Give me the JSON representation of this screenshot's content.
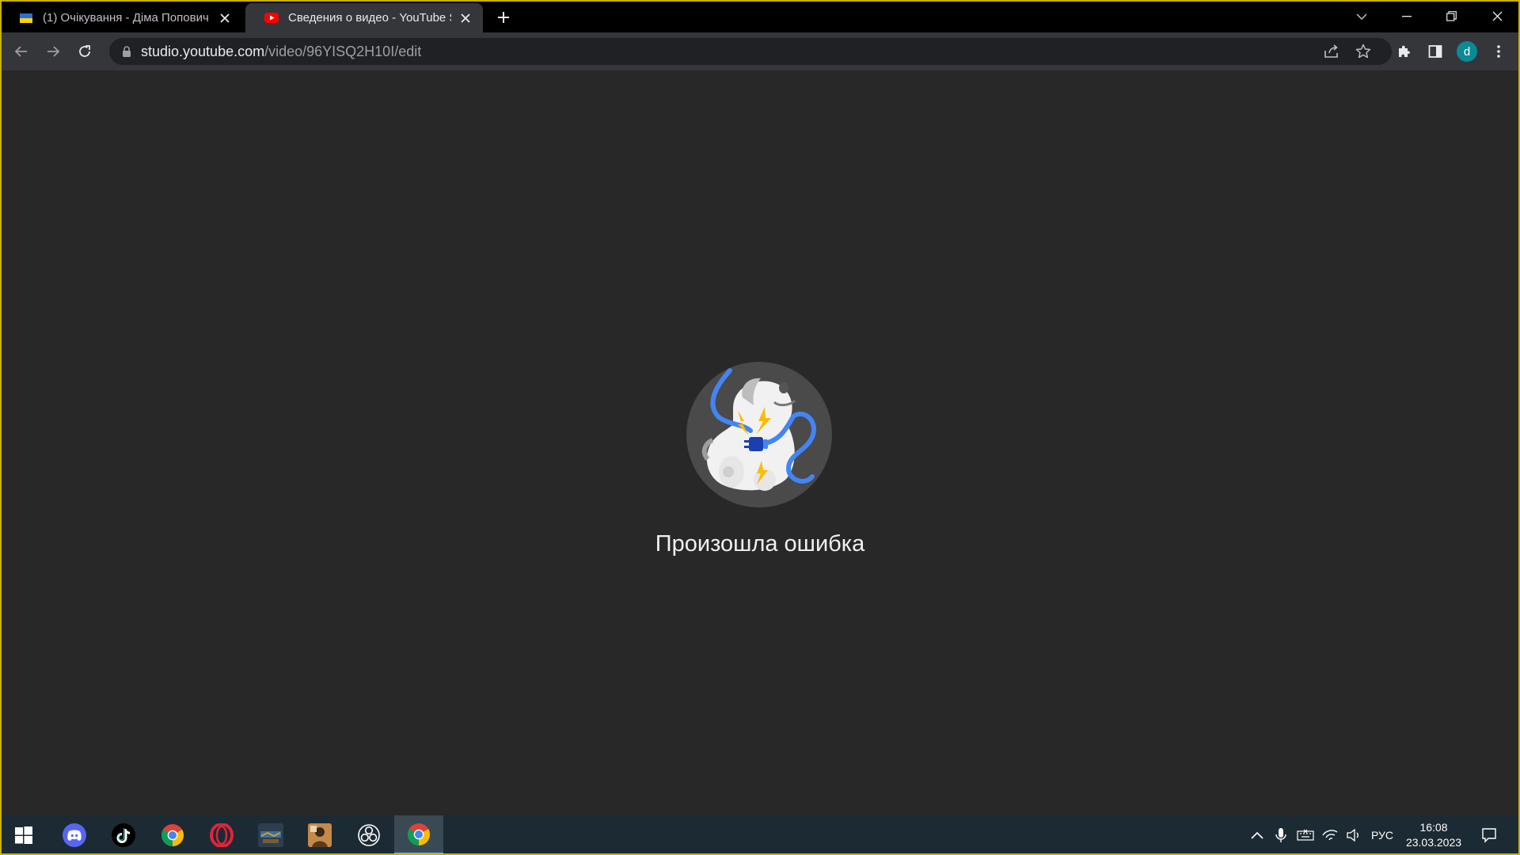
{
  "browser": {
    "tabs": [
      {
        "title": "(1) Очікування - Діма Попович",
        "active": false,
        "favicon": "ukraine-flag-icon"
      },
      {
        "title": "Сведения о видео - YouTube Studio",
        "active": true,
        "favicon": "youtube-icon"
      }
    ],
    "address": {
      "host": "studio.youtube.com",
      "path": "/video/96YISQ2H10I/edit"
    },
    "profile_initial": "d"
  },
  "page": {
    "error_message": "Произошла ошибка"
  },
  "taskbar": {
    "apps": [
      "windows-start-icon",
      "discord-icon",
      "tiktok-icon",
      "chrome-icon",
      "opera-icon",
      "game-icon",
      "game-icon-2",
      "obs-icon",
      "chrome-icon"
    ],
    "language": "РУС",
    "time": "16:08",
    "date": "23.03.2023"
  },
  "colors": {
    "page_bg": "#282828",
    "tabstrip_bg": "#000000",
    "toolbar_bg": "#35363a",
    "omnibox_bg": "#202124",
    "taskbar_bg": "#1c2a33",
    "accent_blue": "#4285f4",
    "frame_yellow": "#c9b000"
  }
}
